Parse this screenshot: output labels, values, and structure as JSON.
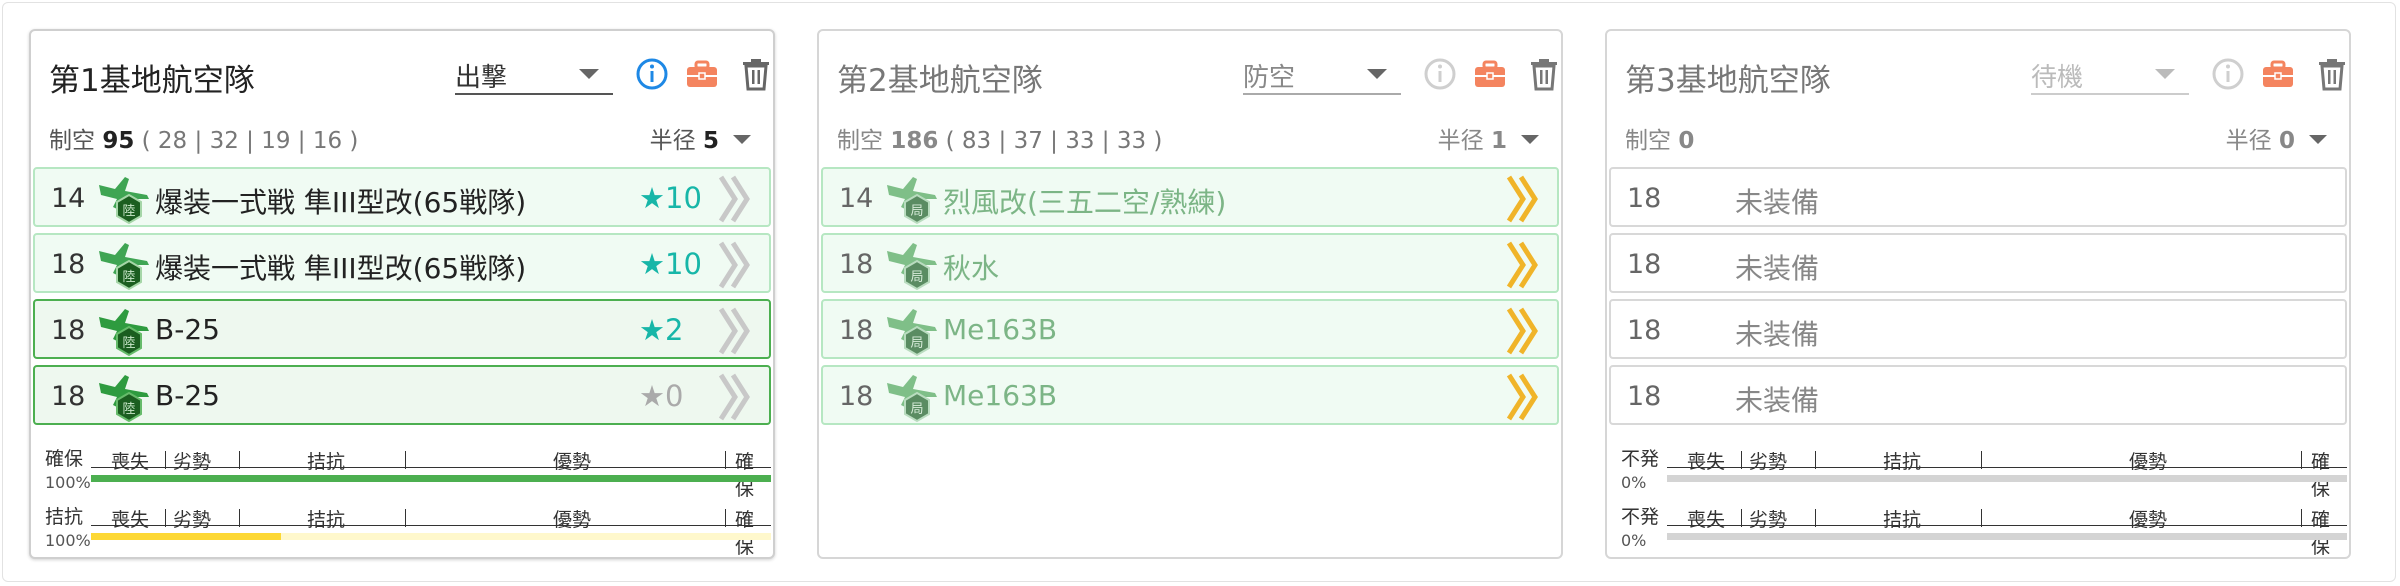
{
  "cards": [
    {
      "title": "第1基地航空隊",
      "mode": "出撃",
      "air_label": "制空",
      "air_value": "95",
      "air_detail": "( 28 | 32 | 19 | 16 )",
      "radius_label": "半径",
      "radius_value": "5",
      "slots": [
        {
          "count": "14",
          "name": "爆装一式戦 隼III型改(65戦隊)",
          "stars": "★10"
        },
        {
          "count": "18",
          "name": "爆装一式戦 隼III型改(65戦隊)",
          "stars": "★10"
        },
        {
          "count": "18",
          "name": "B-25",
          "stars": "★2"
        },
        {
          "count": "18",
          "name": "B-25",
          "stars": "★0"
        }
      ],
      "gauges": [
        {
          "label": "確保",
          "percent": "100%",
          "segments": [
            "喪失",
            "劣勢",
            "拮抗",
            "優勢",
            "確保"
          ],
          "fill_color": "#4caf50",
          "fill_fraction": 1.0,
          "track_color": "#d4d4d4"
        },
        {
          "label": "拮抗",
          "percent": "100%",
          "segments": [
            "喪失",
            "劣勢",
            "拮抗",
            "優勢",
            "確保"
          ],
          "fill_color": "#fdd835",
          "fill_fraction": 0.28,
          "track_color": "#fff8cc"
        }
      ]
    },
    {
      "title": "第2基地航空隊",
      "mode": "防空",
      "air_label": "制空",
      "air_value": "186",
      "air_detail": "( 83 | 37 | 33 | 33 )",
      "radius_label": "半径",
      "radius_value": "1",
      "slots": [
        {
          "count": "14",
          "name": "烈風改(三五二空/熟練)"
        },
        {
          "count": "18",
          "name": "秋水"
        },
        {
          "count": "18",
          "name": "Me163B"
        },
        {
          "count": "18",
          "name": "Me163B"
        }
      ]
    },
    {
      "title": "第3基地航空隊",
      "mode": "待機",
      "air_label": "制空",
      "air_value": "0",
      "radius_label": "半径",
      "radius_value": "0",
      "slots": [
        {
          "count": "18",
          "name": "未装備"
        },
        {
          "count": "18",
          "name": "未装備"
        },
        {
          "count": "18",
          "name": "未装備"
        },
        {
          "count": "18",
          "name": "未装備"
        }
      ],
      "gauges": [
        {
          "label": "不発",
          "percent": "0%",
          "segments": [
            "喪失",
            "劣勢",
            "拮抗",
            "優勢",
            "確保"
          ],
          "fill_color": "#d4d4d4",
          "fill_fraction": 0.0,
          "track_color": "#d4d4d4"
        },
        {
          "label": "不発",
          "percent": "0%",
          "segments": [
            "喪失",
            "劣勢",
            "拮抗",
            "優勢",
            "確保"
          ],
          "fill_color": "#d4d4d4",
          "fill_fraction": 0.0,
          "track_color": "#d4d4d4"
        }
      ]
    }
  ],
  "colors": {
    "info": "#1e88e5",
    "kit": "#f4845f",
    "trash": "#666666",
    "star": "#17b6a8",
    "chevron_gray": "#c8c8c8",
    "chevron_gold": "#f0b429"
  },
  "icons": {
    "info": "info-circle-icon",
    "kit": "toolbox-icon",
    "trash": "trash-icon",
    "plane": "land-based-plane-icon",
    "chevron": "proficiency-chevron-icon"
  }
}
